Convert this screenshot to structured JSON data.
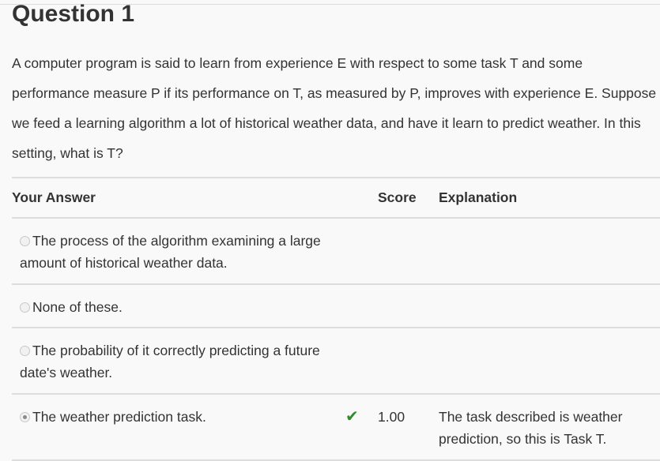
{
  "question": {
    "title": "Question 1",
    "text": "A computer program is said to learn from experience E with respect to some task T and some performance measure P if its performance on T, as measured by P, improves with experience E. Suppose we feed a learning algorithm a lot of historical weather data, and have it learn to predict weather. In this setting, what is T?"
  },
  "table": {
    "headers": {
      "answer": "Your Answer",
      "score": "Score",
      "explanation": "Explanation"
    },
    "rows": [
      {
        "answer": "The process of the algorithm examining a large amount of historical weather data.",
        "selected": false,
        "score": "",
        "explanation": ""
      },
      {
        "answer": "None of these.",
        "selected": false,
        "score": "",
        "explanation": ""
      },
      {
        "answer": "The probability of it correctly predicting a future date's weather.",
        "selected": false,
        "score": "",
        "explanation": ""
      },
      {
        "answer": "The weather prediction task.",
        "selected": true,
        "correct_icon": "checkmark-icon",
        "score": "1.00",
        "explanation": "The task described is weather prediction, so this is Task T."
      }
    ]
  },
  "colors": {
    "correct": "#2e8b2e",
    "rule": "#dddddd",
    "text": "#333333"
  }
}
